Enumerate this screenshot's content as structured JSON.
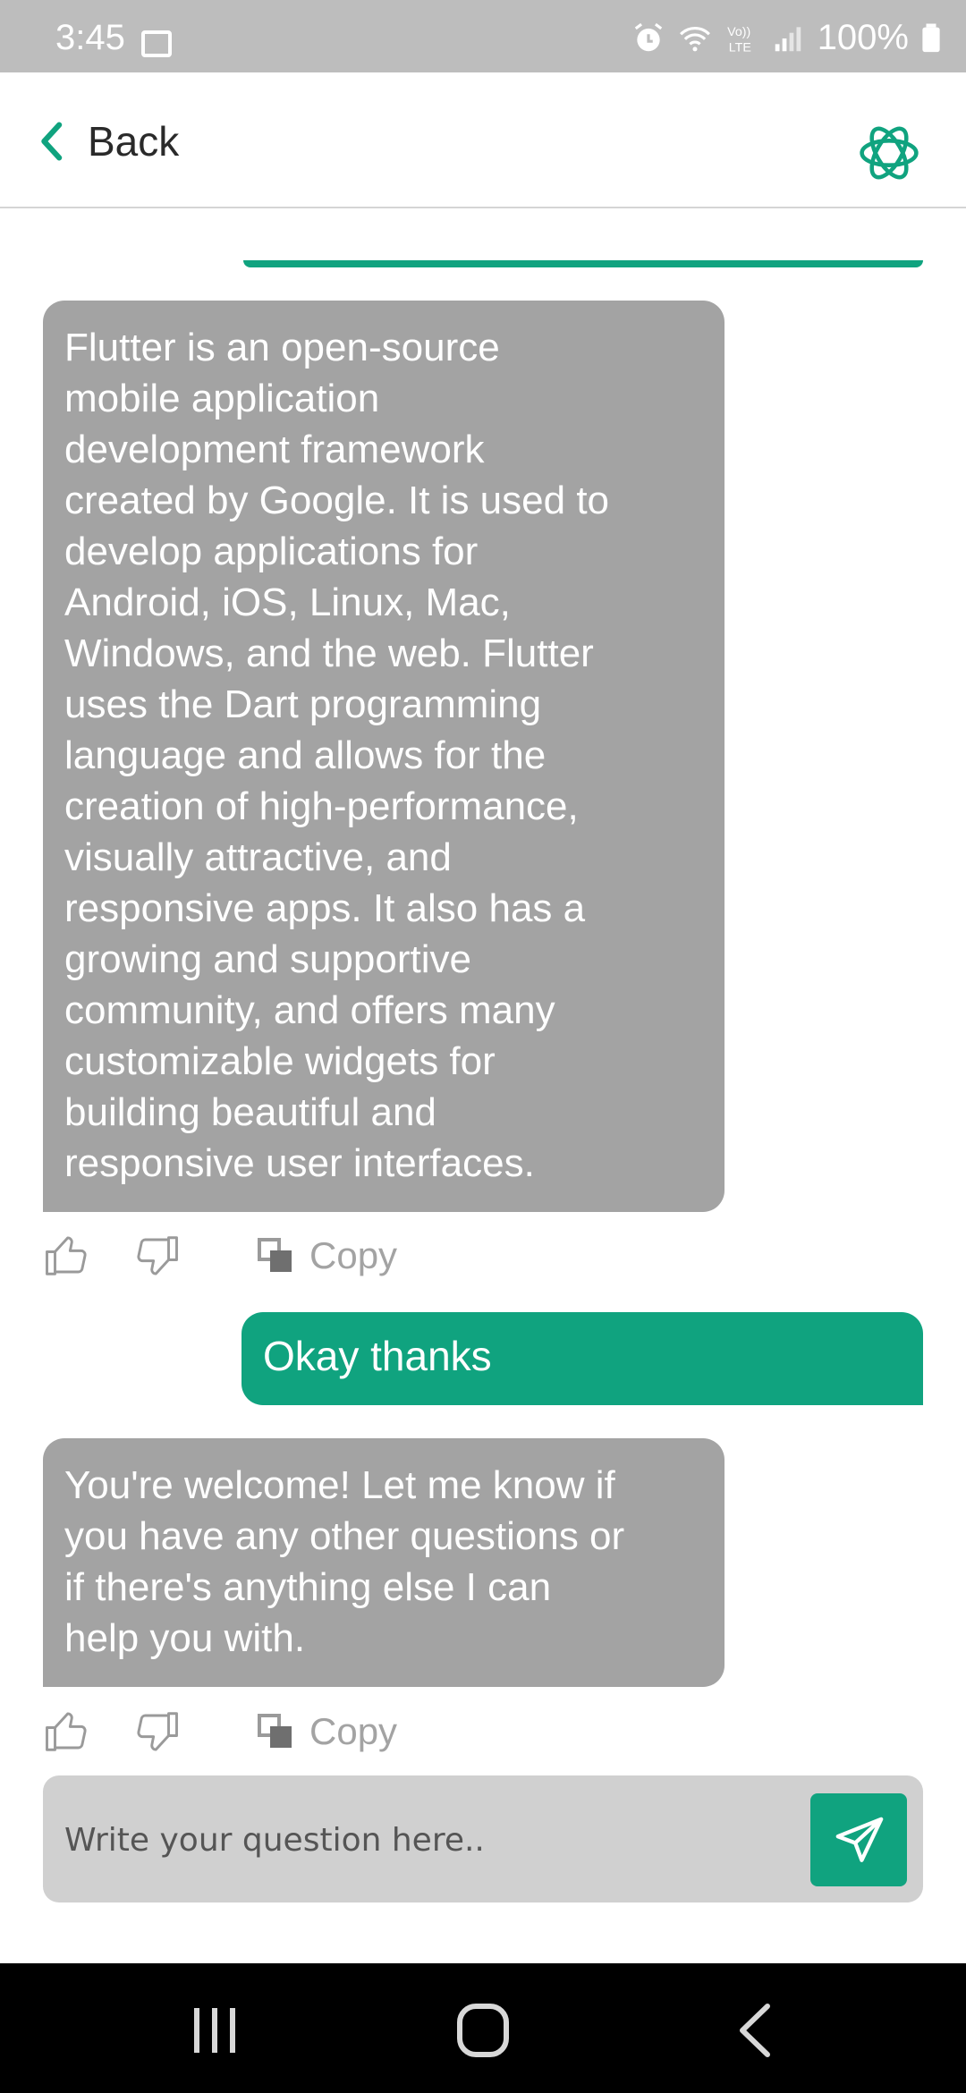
{
  "status_bar": {
    "time": "3:45",
    "battery": "100%",
    "icons": [
      "gallery-icon",
      "alarm-icon",
      "wifi-icon",
      "volte-icon",
      "signal-icon",
      "battery-icon"
    ]
  },
  "header": {
    "back_label": "Back",
    "logo_icon": "openai-logo-icon"
  },
  "messages": [
    {
      "role": "assistant",
      "lines": [
        "Flutter is an open-source",
        "mobile application",
        "development framework",
        "created by Google. It is used to",
        "develop applications for",
        "Android, iOS, Linux, Mac,",
        "Windows, and the web. Flutter",
        "uses the Dart programming",
        "language and allows for the",
        "creation of high-performance,",
        "visually attractive, and",
        "responsive apps. It also has a",
        "growing and supportive",
        "community, and offers many",
        "customizable widgets for",
        "building beautiful and",
        "responsive user interfaces."
      ],
      "copy_label": "Copy"
    },
    {
      "role": "user",
      "text": "Okay thanks"
    },
    {
      "role": "assistant",
      "lines": [
        "You're welcome! Let me know if",
        "you have any other questions or",
        "if there's anything else I can",
        "help you with."
      ],
      "copy_label": "Copy"
    }
  ],
  "composer": {
    "placeholder": "Write your question here..",
    "value": ""
  },
  "colors": {
    "accent": "#10a37f",
    "bot_bubble": "#a3a3a3",
    "status_bar": "#bdbdbd",
    "composer_bg": "#d0d0d0"
  },
  "nav_bar": {
    "icons": [
      "recents-icon",
      "home-icon",
      "back-icon"
    ]
  }
}
